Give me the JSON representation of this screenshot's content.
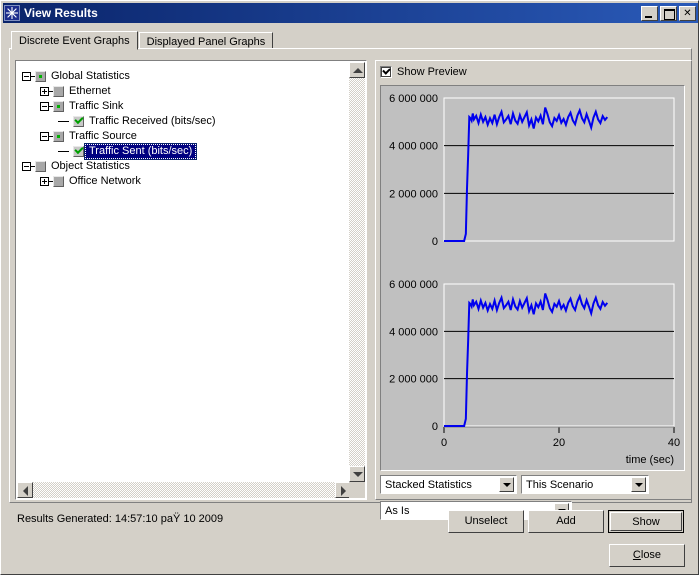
{
  "window": {
    "title": "View Results",
    "icon": "starburst-icon",
    "buttons": {
      "minimize": "_",
      "maximize": "□",
      "close": "✕"
    }
  },
  "tabs": [
    {
      "label": "Discrete Event Graphs",
      "active": true
    },
    {
      "label": "Displayed Panel Graphs",
      "active": false
    }
  ],
  "tree": {
    "nodes": [
      {
        "label": "Global Statistics",
        "depth": 0,
        "expander": "minus",
        "check": "partial",
        "selected": false
      },
      {
        "label": "Ethernet",
        "depth": 1,
        "expander": "plus",
        "check": "unchecked",
        "selected": false
      },
      {
        "label": "Traffic Sink",
        "depth": 1,
        "expander": "minus",
        "check": "partial",
        "selected": false
      },
      {
        "label": "Traffic Received (bits/sec)",
        "depth": 2,
        "expander": "none",
        "check": "checked",
        "selected": false
      },
      {
        "label": "Traffic Source",
        "depth": 1,
        "expander": "minus",
        "check": "partial",
        "selected": false
      },
      {
        "label": "Traffic Sent (bits/sec)",
        "depth": 2,
        "expander": "none",
        "check": "checked",
        "selected": true
      },
      {
        "label": "Object Statistics",
        "depth": 0,
        "expander": "minus",
        "check": "unchecked",
        "selected": false
      },
      {
        "label": "Office Network",
        "depth": 1,
        "expander": "plus",
        "check": "unchecked",
        "selected": false
      }
    ]
  },
  "preview": {
    "show_preview_label": "Show Preview",
    "show_preview_checked": true
  },
  "chart_data": [
    {
      "type": "line",
      "title": "",
      "xlabel": "",
      "ylabel": "",
      "xlim": [
        0,
        40
      ],
      "ylim": [
        0,
        6000000
      ],
      "xticks": [],
      "xticklabels": [],
      "yticks": [
        0,
        2000000,
        4000000,
        6000000
      ],
      "yticklabels": [
        "0",
        "2 000 000",
        "4 000 000",
        "6 000 000"
      ],
      "grid": true,
      "series": [
        {
          "name": "Traffic Received (bits/sec)",
          "color": "#0000ee",
          "x": [
            0,
            0.5,
            1,
            1.5,
            2,
            2.5,
            3,
            3.5,
            3.8,
            4,
            4.2,
            4.4,
            4.6,
            4.8,
            5,
            5.2,
            5.6,
            6,
            6.4,
            6.8,
            7.2,
            7.6,
            8,
            8.4,
            8.8,
            9.2,
            9.6,
            10,
            10.4,
            10.8,
            11.2,
            11.6,
            12,
            12.4,
            12.8,
            13.2,
            13.6,
            14,
            14.4,
            14.8,
            15.2,
            15.6,
            16,
            16.4,
            16.8,
            17.2,
            17.6,
            18,
            18.4,
            18.8,
            19.2,
            19.6,
            20,
            20.4,
            20.8,
            21.2,
            21.6,
            22,
            22.4,
            22.8,
            23.2,
            23.6,
            24,
            24.4,
            24.8,
            25.2,
            25.6,
            26,
            26.4,
            26.8,
            27.2,
            27.6,
            28,
            28.4,
            28.8
          ],
          "y": [
            0,
            0,
            0,
            0,
            0,
            0,
            0,
            0,
            300000,
            2200000,
            3600000,
            5200000,
            5150000,
            5050000,
            5350000,
            5100000,
            5250000,
            4950000,
            5300000,
            5000000,
            5200000,
            4880000,
            5150000,
            4950000,
            5300000,
            4900000,
            5200000,
            5420000,
            4980000,
            5100000,
            5250000,
            4900000,
            5350000,
            5050000,
            4920000,
            5280000,
            5000000,
            5200000,
            5400000,
            4850000,
            5100000,
            4720000,
            5180000,
            5020000,
            5260000,
            4900000,
            5600000,
            5320000,
            4980000,
            4820000,
            5160000,
            5040000,
            5280000,
            4960000,
            5120000,
            4880000,
            5200000,
            5380000,
            5060000,
            4900000,
            5260000,
            5480000,
            5150000,
            4980000,
            5320000,
            5050000,
            4760000,
            5180000,
            5420000,
            5100000,
            4950000,
            5240000,
            5080000,
            5200000
          ]
        }
      ]
    },
    {
      "type": "line",
      "title": "",
      "xlabel": "time (sec)",
      "ylabel": "",
      "xlim": [
        0,
        40
      ],
      "ylim": [
        0,
        6000000
      ],
      "xticks": [
        0,
        20,
        40
      ],
      "xticklabels": [
        "0",
        "20",
        "40"
      ],
      "yticks": [
        0,
        2000000,
        4000000,
        6000000
      ],
      "yticklabels": [
        "0",
        "2 000 000",
        "4 000 000",
        "6 000 000"
      ],
      "grid": true,
      "series": [
        {
          "name": "Traffic Sent (bits/sec)",
          "color": "#0000ee",
          "x": [
            0,
            0.5,
            1,
            1.5,
            2,
            2.5,
            3,
            3.5,
            3.8,
            4,
            4.2,
            4.4,
            4.6,
            4.8,
            5,
            5.2,
            5.6,
            6,
            6.4,
            6.8,
            7.2,
            7.6,
            8,
            8.4,
            8.8,
            9.2,
            9.6,
            10,
            10.4,
            10.8,
            11.2,
            11.6,
            12,
            12.4,
            12.8,
            13.2,
            13.6,
            14,
            14.4,
            14.8,
            15.2,
            15.6,
            16,
            16.4,
            16.8,
            17.2,
            17.6,
            18,
            18.4,
            18.8,
            19.2,
            19.6,
            20,
            20.4,
            20.8,
            21.2,
            21.6,
            22,
            22.4,
            22.8,
            23.2,
            23.6,
            24,
            24.4,
            24.8,
            25.2,
            25.6,
            26,
            26.4,
            26.8,
            27.2,
            27.6,
            28,
            28.4,
            28.8
          ],
          "y": [
            0,
            0,
            0,
            0,
            0,
            0,
            0,
            0,
            300000,
            2200000,
            3600000,
            5200000,
            5150000,
            5050000,
            5350000,
            5100000,
            5250000,
            4950000,
            5300000,
            5000000,
            5200000,
            4880000,
            5150000,
            4950000,
            5300000,
            4900000,
            5200000,
            5420000,
            4980000,
            5100000,
            5250000,
            4900000,
            5350000,
            5050000,
            4920000,
            5280000,
            5000000,
            5200000,
            5400000,
            4850000,
            5100000,
            4720000,
            5180000,
            5020000,
            5260000,
            4900000,
            5600000,
            5320000,
            4980000,
            4820000,
            5160000,
            5040000,
            5280000,
            4960000,
            5120000,
            4880000,
            5200000,
            5380000,
            5060000,
            4900000,
            5260000,
            5480000,
            5150000,
            4980000,
            5320000,
            5050000,
            4760000,
            5180000,
            5420000,
            5100000,
            4950000,
            5240000,
            5080000,
            5200000
          ]
        }
      ]
    }
  ],
  "controls": {
    "stacked_statistics": "Stacked Statistics",
    "scenario": "This Scenario",
    "asis": "As Is"
  },
  "status": {
    "text": "Results Generated: 14:57:10 paŸ 10 2009"
  },
  "actions": {
    "unselect": "Unselect",
    "add": "Add",
    "show": "Show",
    "close": "Close"
  }
}
